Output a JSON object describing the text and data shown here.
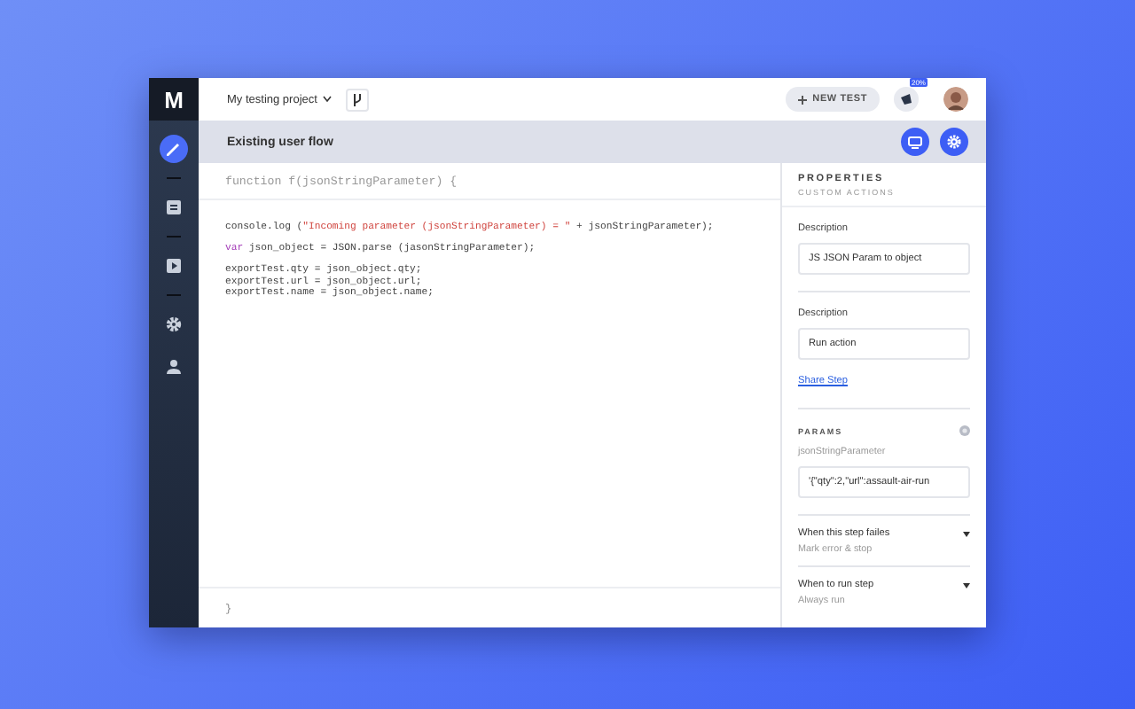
{
  "sidebar": {
    "logo": "M",
    "items": [
      {
        "kind": "pencil",
        "selected": true
      },
      {
        "kind": "list",
        "selected": false
      },
      {
        "kind": "play",
        "selected": false
      },
      {
        "kind": "gear",
        "selected": false
      },
      {
        "kind": "user",
        "selected": false
      }
    ]
  },
  "topbar": {
    "project": "My testing project",
    "new_test": "NEW TEST",
    "badge": "20%"
  },
  "flow_title": "Existing user flow",
  "editor": {
    "signature": "function f(jsonStringParameter) {",
    "blocks": [
      [
        [
          {
            "kind": "plain",
            "text": "console.log ("
          },
          {
            "kind": "string",
            "text": "\"Incoming parameter (jsonStringParameter) = \""
          },
          {
            "kind": "plain",
            "text": " + jsonStringParameter);"
          }
        ]
      ],
      [
        [
          {
            "kind": "keyword",
            "text": "var"
          },
          {
            "kind": "plain",
            "text": " json_object = JSON.parse (jasonStringParameter);"
          }
        ]
      ],
      [
        [
          {
            "kind": "plain",
            "text": "exportTest.qty = json_object.qty;"
          }
        ],
        [
          {
            "kind": "plain",
            "text": "exportTest.url = json_object.url;"
          }
        ],
        [
          {
            "kind": "plain",
            "text": "exportTest.name = json_object.name;"
          }
        ]
      ]
    ],
    "closing": "}"
  },
  "properties": {
    "title": "PROPERTIES",
    "subtitle": "CUSTOM ACTIONS",
    "fields": [
      {
        "label": "Description",
        "value": "JS JSON Param to object"
      },
      {
        "label": "Description",
        "value": "Run action"
      }
    ],
    "link": "Share Step",
    "params": {
      "title": "PARAMS",
      "name": "jsonStringParameter",
      "value": "'{\"qty\":2,\"url\":assault-air-run"
    },
    "dropdowns": [
      {
        "label": "When this step failes",
        "value": "Mark error & stop"
      },
      {
        "label": "When to run step",
        "value": "Always run"
      }
    ]
  }
}
